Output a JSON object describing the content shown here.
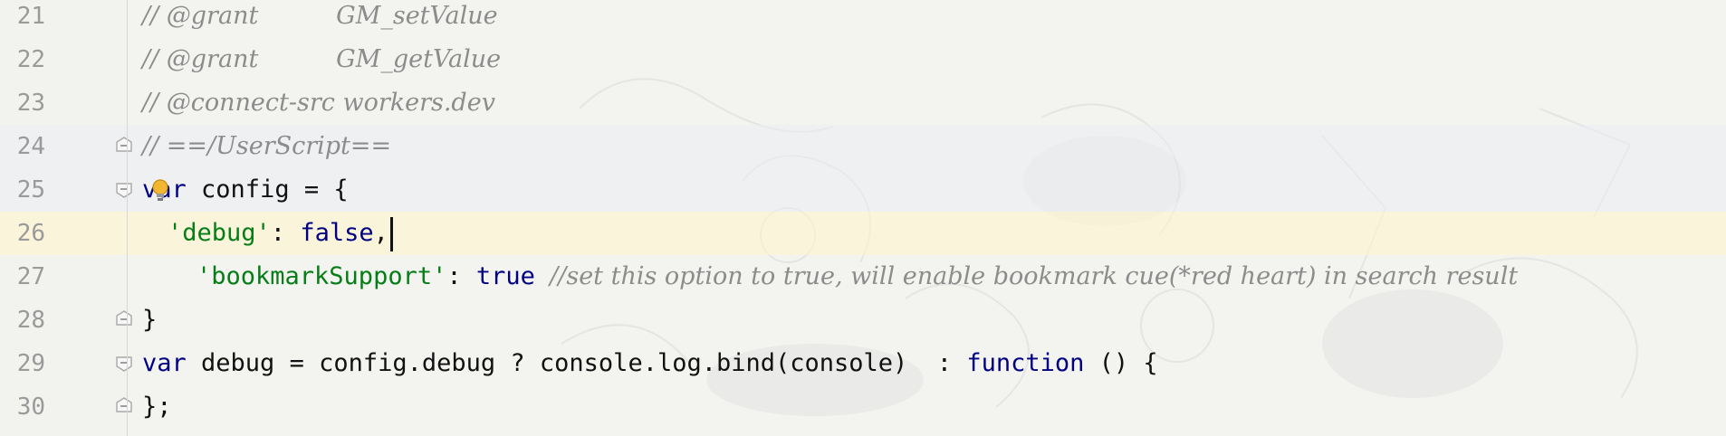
{
  "editor": {
    "lines": [
      {
        "number": "21",
        "comment": "// @grant          GM_setValue"
      },
      {
        "number": "22",
        "comment": "// @grant          GM_getValue"
      },
      {
        "number": "23",
        "comment": "// @connect-src workers.dev"
      },
      {
        "number": "24",
        "comment": "// ==/UserScript=="
      },
      {
        "number": "25",
        "kw": "var",
        "rest": " config = {"
      },
      {
        "number": "26",
        "str": "'debug'",
        "mid": ": ",
        "kw": "false",
        "rest": ","
      },
      {
        "number": "27",
        "str": "'bookmarkSupport'",
        "mid": ": ",
        "kw": "true",
        "rest": " ",
        "comment": "//set this option to true, will enable bookmark cue(*red heart) in search result"
      },
      {
        "number": "28",
        "rest": "}"
      },
      {
        "number": "29",
        "kw": "var",
        "rest": " debug = config.debug ? console.log.bind(console)  : ",
        "kw2": "function",
        "rest2": " () {"
      },
      {
        "number": "30",
        "rest": "};"
      }
    ],
    "current_line": "26",
    "colors": {
      "keyword": "#000080",
      "string": "#067d17",
      "comment": "#8c8c8c",
      "line_number": "#9a9a9a",
      "current_line_bg": "#fff5c8"
    }
  }
}
